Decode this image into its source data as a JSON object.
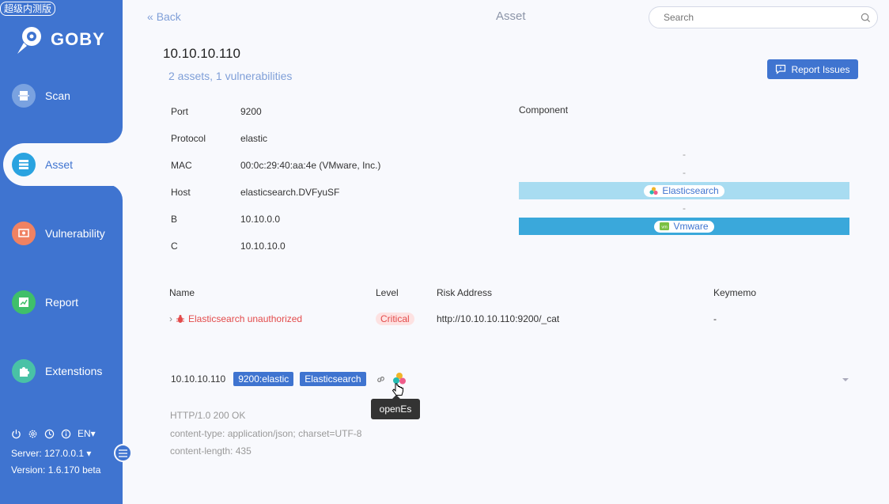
{
  "sidebar": {
    "beta_badge": "超级内测版",
    "logo": "GOBY",
    "items": [
      {
        "label": "Scan",
        "color": "#ffffff"
      },
      {
        "label": "Asset",
        "color": "#2aa3e0"
      },
      {
        "label": "Vulnerability",
        "color": "#f08262"
      },
      {
        "label": "Report",
        "color": "#3fbf6a"
      },
      {
        "label": "Extenstions",
        "color": "#49c2a6"
      }
    ],
    "language": "EN",
    "server": "Server: 127.0.0.1",
    "version": "Version: 1.6.170 beta"
  },
  "header": {
    "back": "Back",
    "title": "Asset",
    "search_placeholder": "Search"
  },
  "asset": {
    "ip": "10.10.10.110",
    "summary": "2 assets, 1 vulnerabilities",
    "report_button": "Report Issues"
  },
  "info": [
    {
      "key": "Port",
      "value": "9200"
    },
    {
      "key": "Protocol",
      "value": "elastic"
    },
    {
      "key": "MAC",
      "value": "00:0c:29:40:aa:4e (VMware, Inc.)"
    },
    {
      "key": "Host",
      "value": "elasticsearch.DVFyuSF"
    },
    {
      "key": "B",
      "value": "10.10.0.0"
    },
    {
      "key": "C",
      "value": "10.10.10.0"
    }
  ],
  "component": {
    "title": "Component",
    "rows": [
      {
        "type": "dash",
        "text": "-"
      },
      {
        "type": "dash",
        "text": "-"
      },
      {
        "type": "bar",
        "text": "Elasticsearch",
        "bg": "#a8dcf1"
      },
      {
        "type": "dash",
        "text": "-"
      },
      {
        "type": "bar",
        "text": "Vmware",
        "bg": "#3aa8db"
      }
    ]
  },
  "vulns": {
    "headers": {
      "name": "Name",
      "level": "Level",
      "risk": "Risk Address",
      "keymemo": "Keymemo"
    },
    "rows": [
      {
        "name": "Elasticsearch unauthorized",
        "level": "Critical",
        "risk": "http://10.10.10.110:9200/_cat",
        "keymemo": "-"
      }
    ]
  },
  "port_line": {
    "ip": "10.10.10.110",
    "tag1": "9200:elastic",
    "tag2": "Elasticsearch",
    "tooltip": "openEs"
  },
  "http": [
    "HTTP/1.0 200 OK",
    "content-type: application/json; charset=UTF-8",
    "content-length: 435"
  ]
}
